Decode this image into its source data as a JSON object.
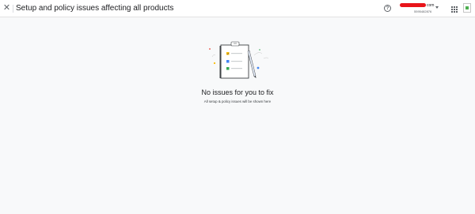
{
  "header": {
    "close_icon": "close-icon",
    "title": "Setup and policy issues affecting all products",
    "help_icon": "help-icon",
    "account_email_suffix": "com",
    "account_id": "5595482876",
    "apps_icon": "apps-grid-icon"
  },
  "empty_state": {
    "title": "No issues for you to fix",
    "subtitle": "All setup & policy issues will be shown here"
  },
  "colors": {
    "accent_blue": "#4285f4",
    "accent_yellow": "#fbbc04",
    "accent_green": "#34a853",
    "accent_red": "#ea4335"
  }
}
